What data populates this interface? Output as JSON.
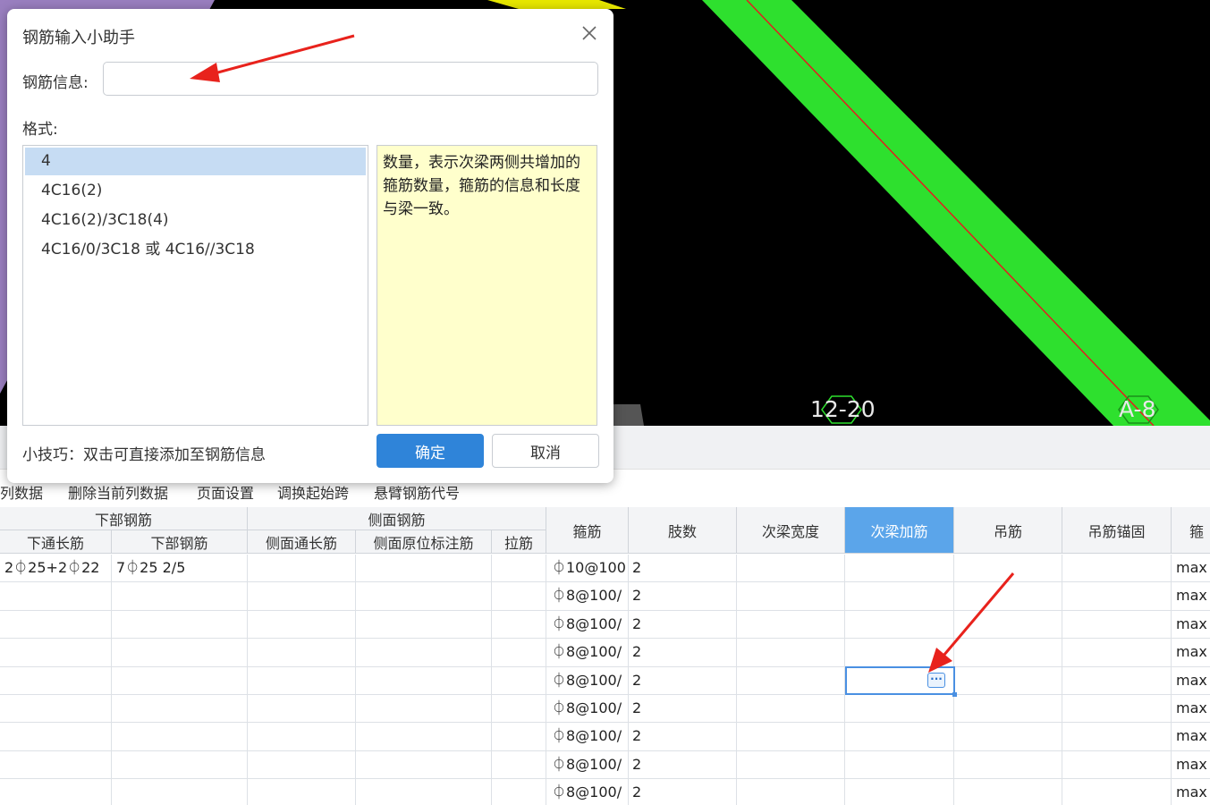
{
  "viewport": {
    "axis_labels": [
      "12-20",
      "A-8"
    ],
    "beam_color": "#2ee02e",
    "centerline_color": "#e02020"
  },
  "toolbar": {
    "items": [
      "列数据",
      "删除当前列数据",
      "页面设置",
      "调换起始跨",
      "悬臂钢筋代号"
    ]
  },
  "table": {
    "group_headers": {
      "bottom_rebar": "下部钢筋",
      "side_rebar": "侧面钢筋"
    },
    "sub_headers": {
      "bottom_through": "下通长筋",
      "bottom_rebar": "下部钢筋",
      "side_through": "侧面通长筋",
      "side_in_situ": "侧面原位标注筋",
      "tie_bar": "拉筋"
    },
    "headers": {
      "stirrup": "箍筋",
      "legs": "肢数",
      "secondary_beam_width": "次梁宽度",
      "secondary_beam_extra": "次梁加筋",
      "hanger_bar": "吊筋",
      "hanger_anchor": "吊筋锚固",
      "last": "箍"
    },
    "rows": [
      {
        "bottom_through": "2⏀25+2⏀22",
        "bottom_rebar": "7⏀25 2/5",
        "stirrup": "⏀10@100",
        "legs": "2",
        "last": "max"
      },
      {
        "bottom_through": "",
        "bottom_rebar": "",
        "stirrup": "⏀8@100/",
        "legs": "2",
        "last": "max"
      },
      {
        "bottom_through": "",
        "bottom_rebar": "",
        "stirrup": "⏀8@100/",
        "legs": "2",
        "last": "max"
      },
      {
        "bottom_through": "",
        "bottom_rebar": "",
        "stirrup": "⏀8@100/",
        "legs": "2",
        "last": "max"
      },
      {
        "bottom_through": "",
        "bottom_rebar": "",
        "stirrup": "⏀8@100/",
        "legs": "2",
        "last": "max"
      },
      {
        "bottom_through": "",
        "bottom_rebar": "",
        "stirrup": "⏀8@100/",
        "legs": "2",
        "last": "max"
      },
      {
        "bottom_through": "",
        "bottom_rebar": "",
        "stirrup": "⏀8@100/",
        "legs": "2",
        "last": "max"
      },
      {
        "bottom_through": "",
        "bottom_rebar": "",
        "stirrup": "⏀8@100/",
        "legs": "2",
        "last": "max"
      },
      {
        "bottom_through": "",
        "bottom_rebar": "",
        "stirrup": "⏀8@100/",
        "legs": "2",
        "last": "max"
      }
    ],
    "ellipsis_label": "···"
  },
  "dialog": {
    "title": "钢筋输入小助手",
    "info_label": "钢筋信息:",
    "info_value": "",
    "format_label": "格式:",
    "format_items": [
      "4",
      "4C16(2)",
      "4C16(2)/3C18(4)",
      "4C16/0/3C18 或 4C16//3C18"
    ],
    "selected_index": 0,
    "description": "数量，表示次梁两侧共增加的箍筋数量，箍筋的信息和长度与梁一致。",
    "tip": "小技巧：双击可直接添加至钢筋信息",
    "ok_label": "确定",
    "cancel_label": "取消"
  },
  "colors": {
    "accent": "#2f84d9",
    "active_header": "#5ba5ea",
    "annotation_arrow": "#e8221c",
    "description_bg": "#ffffcc"
  }
}
